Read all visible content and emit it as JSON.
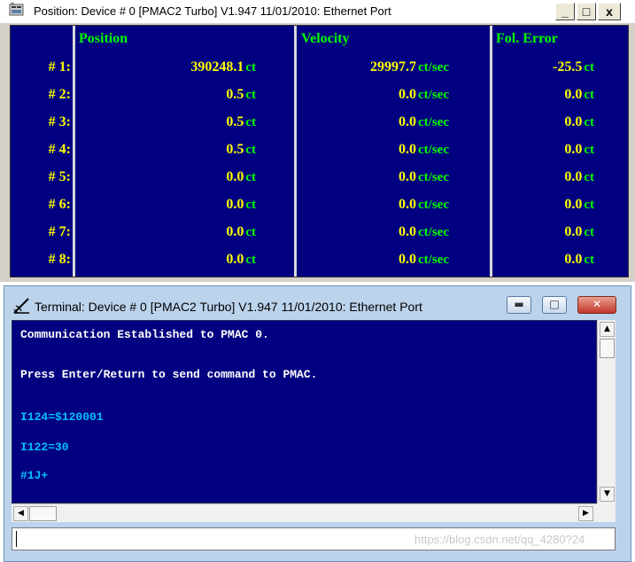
{
  "position_window": {
    "title": "Position: Device # 0 [PMAC2 Turbo] V1.947    11/01/2010: Ethernet Port",
    "buttons": {
      "minimize": "_",
      "maximize": "□",
      "close": "x"
    },
    "headers": {
      "position": "Position",
      "velocity": "Velocity",
      "fol_error": "Fol. Error"
    },
    "units": {
      "position": "ct",
      "velocity": "ct/sec",
      "fol_error": "ct"
    },
    "rows": [
      {
        "label": "# 1:",
        "position": "390248.1",
        "velocity": "29997.7",
        "fol_error": "-25.5"
      },
      {
        "label": "# 2:",
        "position": "0.5",
        "velocity": "0.0",
        "fol_error": "0.0"
      },
      {
        "label": "# 3:",
        "position": "0.5",
        "velocity": "0.0",
        "fol_error": "0.0"
      },
      {
        "label": "# 4:",
        "position": "0.5",
        "velocity": "0.0",
        "fol_error": "0.0"
      },
      {
        "label": "# 5:",
        "position": "0.0",
        "velocity": "0.0",
        "fol_error": "0.0"
      },
      {
        "label": "# 6:",
        "position": "0.0",
        "velocity": "0.0",
        "fol_error": "0.0"
      },
      {
        "label": "# 7:",
        "position": "0.0",
        "velocity": "0.0",
        "fol_error": "0.0"
      },
      {
        "label": "# 8:",
        "position": "0.0",
        "velocity": "0.0",
        "fol_error": "0.0"
      }
    ]
  },
  "terminal_window": {
    "title": "Terminal: Device # 0 [PMAC2 Turbo] V1.947    11/01/2010: Ethernet Port",
    "lines": [
      "Communication Established to PMAC 0.",
      "Press Enter/Return to send command to PMAC.",
      "I124=$120001",
      "I122=30",
      "#1J+"
    ],
    "command_input": "",
    "watermark": "https://blog.csdn.net/qq_4280?24"
  },
  "colors": {
    "panel_background": "#000080",
    "value_yellow": "#ffff00",
    "unit_green": "#00ff00",
    "terminal_cyan": "#00c0ff"
  },
  "icons": {
    "position_app": "position-window-app-icon",
    "terminal_app": "terminal-pen-icon"
  }
}
